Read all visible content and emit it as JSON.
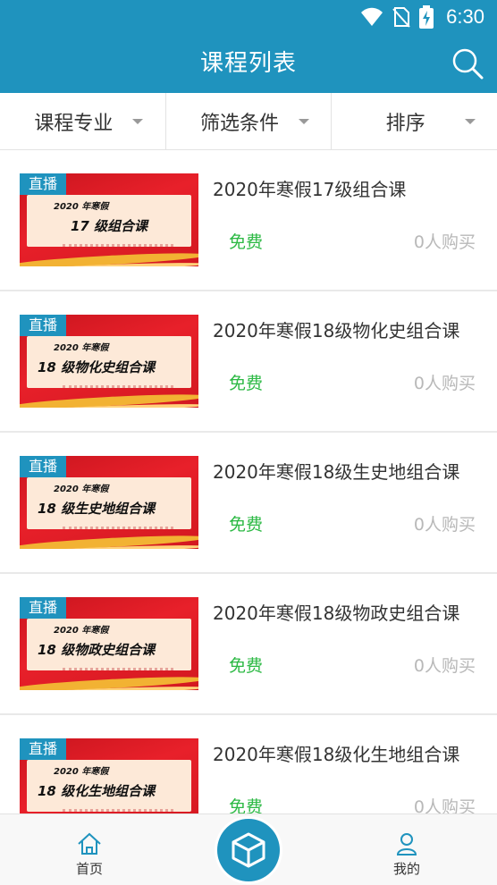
{
  "status": {
    "time": "6:30"
  },
  "appbar": {
    "title": "课程列表"
  },
  "filters": [
    {
      "label": "课程专业"
    },
    {
      "label": "筛选条件"
    },
    {
      "label": "排序"
    }
  ],
  "courses": [
    {
      "badge": "直播",
      "thumb_year": "2020 年寒假",
      "thumb_title": "17 级组合课",
      "title": "2020年寒假17级组合课",
      "price": "免费",
      "buyers": "0人购买"
    },
    {
      "badge": "直播",
      "thumb_year": "2020 年寒假",
      "thumb_title": "18 级物化史组合课",
      "title": "2020年寒假18级物化史组合课",
      "price": "免费",
      "buyers": "0人购买"
    },
    {
      "badge": "直播",
      "thumb_year": "2020 年寒假",
      "thumb_title": "18 级生史地组合课",
      "title": "2020年寒假18级生史地组合课",
      "price": "免费",
      "buyers": "0人购买"
    },
    {
      "badge": "直播",
      "thumb_year": "2020 年寒假",
      "thumb_title": "18 级物政史组合课",
      "title": "2020年寒假18级物政史组合课",
      "price": "免费",
      "buyers": "0人购买"
    },
    {
      "badge": "直播",
      "thumb_year": "2020 年寒假",
      "thumb_title": "18 级化生地组合课",
      "title": "2020年寒假18级化生地组合课",
      "price": "免费",
      "buyers": "0人购买"
    }
  ],
  "tabbar": {
    "home": "首页",
    "me": "我的"
  },
  "icons": {
    "wifi": "wifi-icon",
    "signal": "no-sim-icon",
    "battery": "battery-charging-icon",
    "search": "search-icon",
    "home": "home-icon",
    "center": "cube-icon",
    "user": "user-icon"
  },
  "colors": {
    "primary": "#1f93be",
    "free": "#2cb944",
    "muted": "#b8b8b8"
  }
}
